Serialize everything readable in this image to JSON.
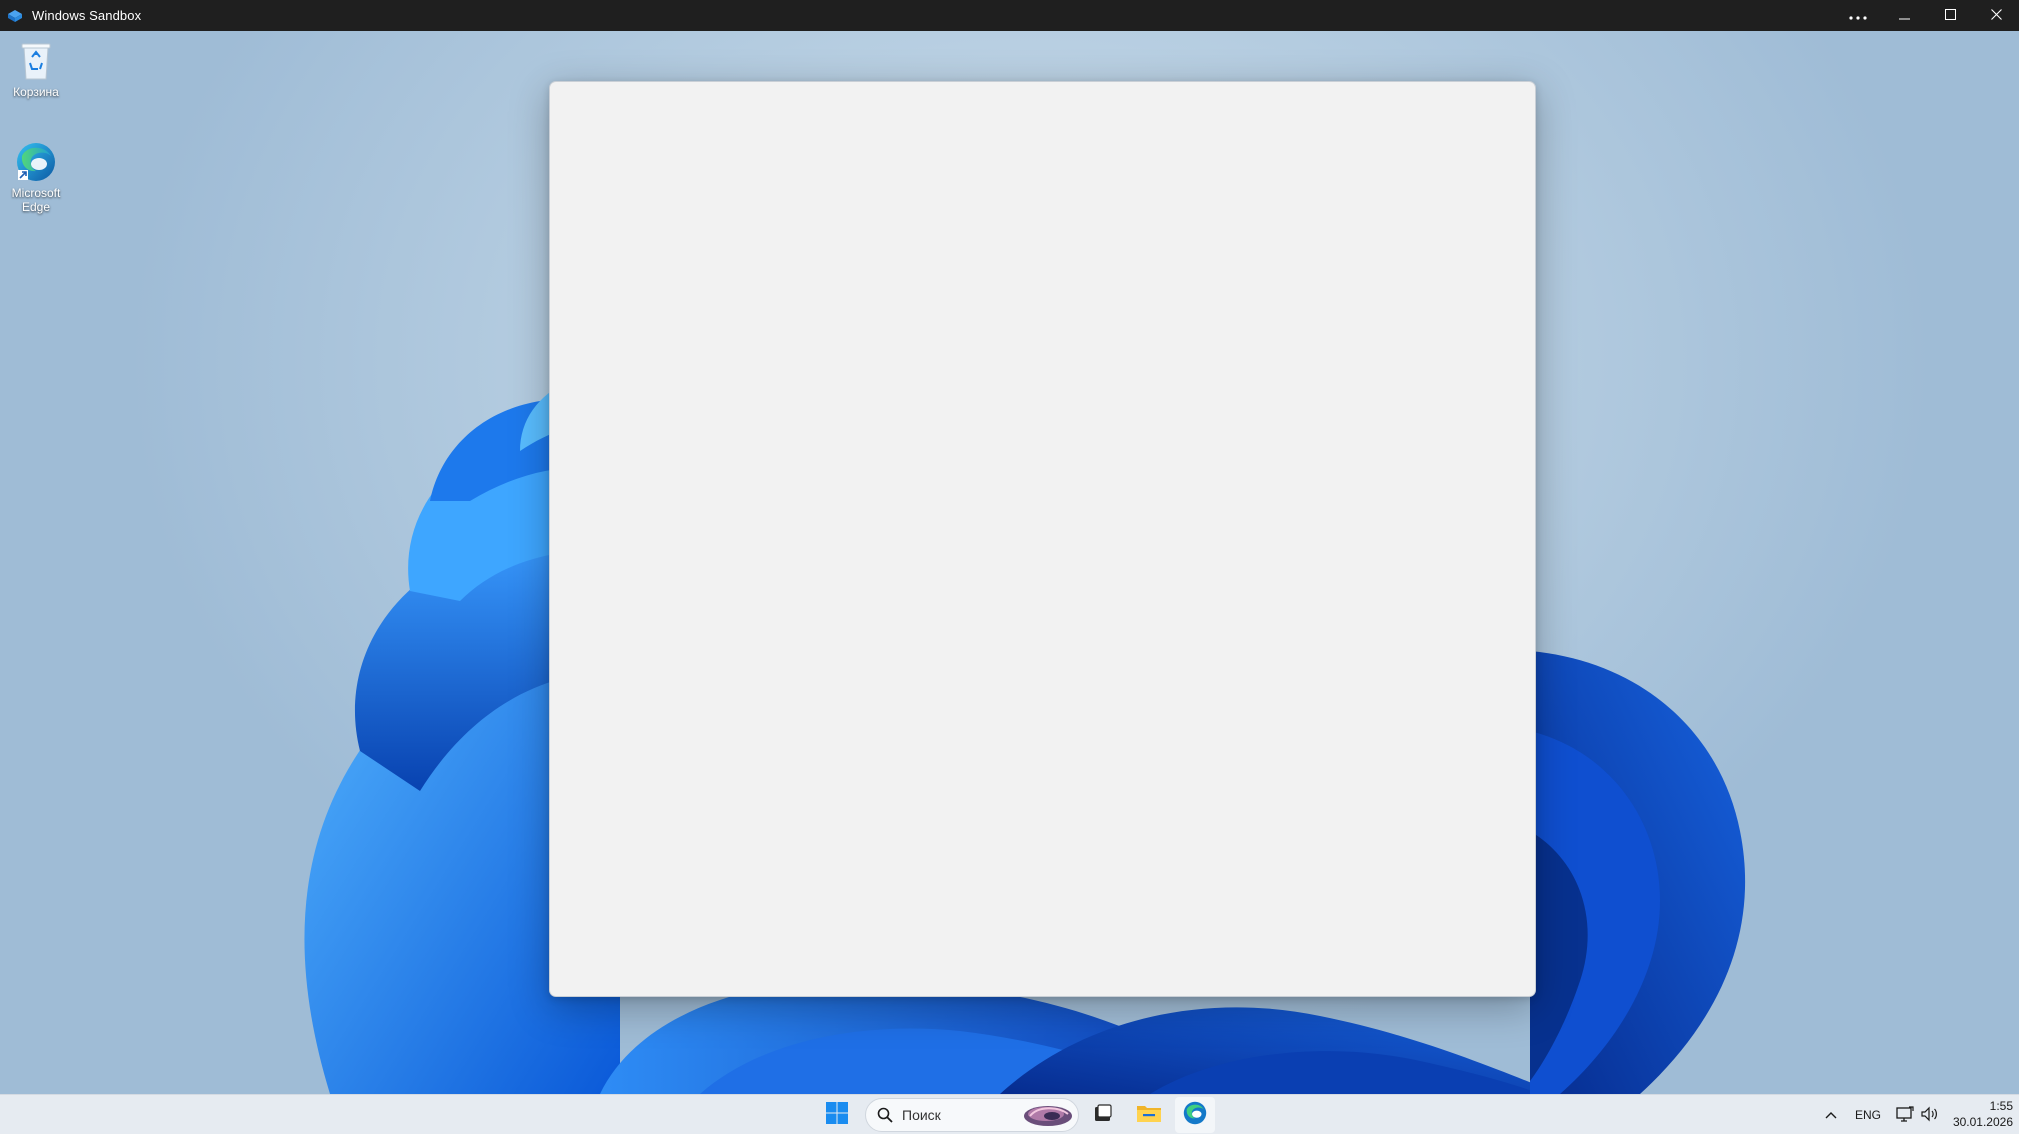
{
  "host_window": {
    "title": "Windows Sandbox"
  },
  "desktop": {
    "icons": [
      {
        "label": "Корзина",
        "icon": "recycle-bin-icon"
      },
      {
        "label": "Microsoft Edge",
        "icon": "edge-icon"
      }
    ]
  },
  "taskbar": {
    "search_placeholder": "Поиск",
    "pinned": [
      "start-icon",
      "search-icon",
      "task-view-icon",
      "file-explorer-icon",
      "edge-icon"
    ],
    "tray": {
      "language": "ENG",
      "time": "1:55",
      "date": "30.01.2026"
    }
  },
  "colors": {
    "titlebar": "#1f1f1f",
    "window_bg": "#f2f2f2",
    "taskbar_bg": "#e6ebf1",
    "accent": "#0a64d6"
  }
}
